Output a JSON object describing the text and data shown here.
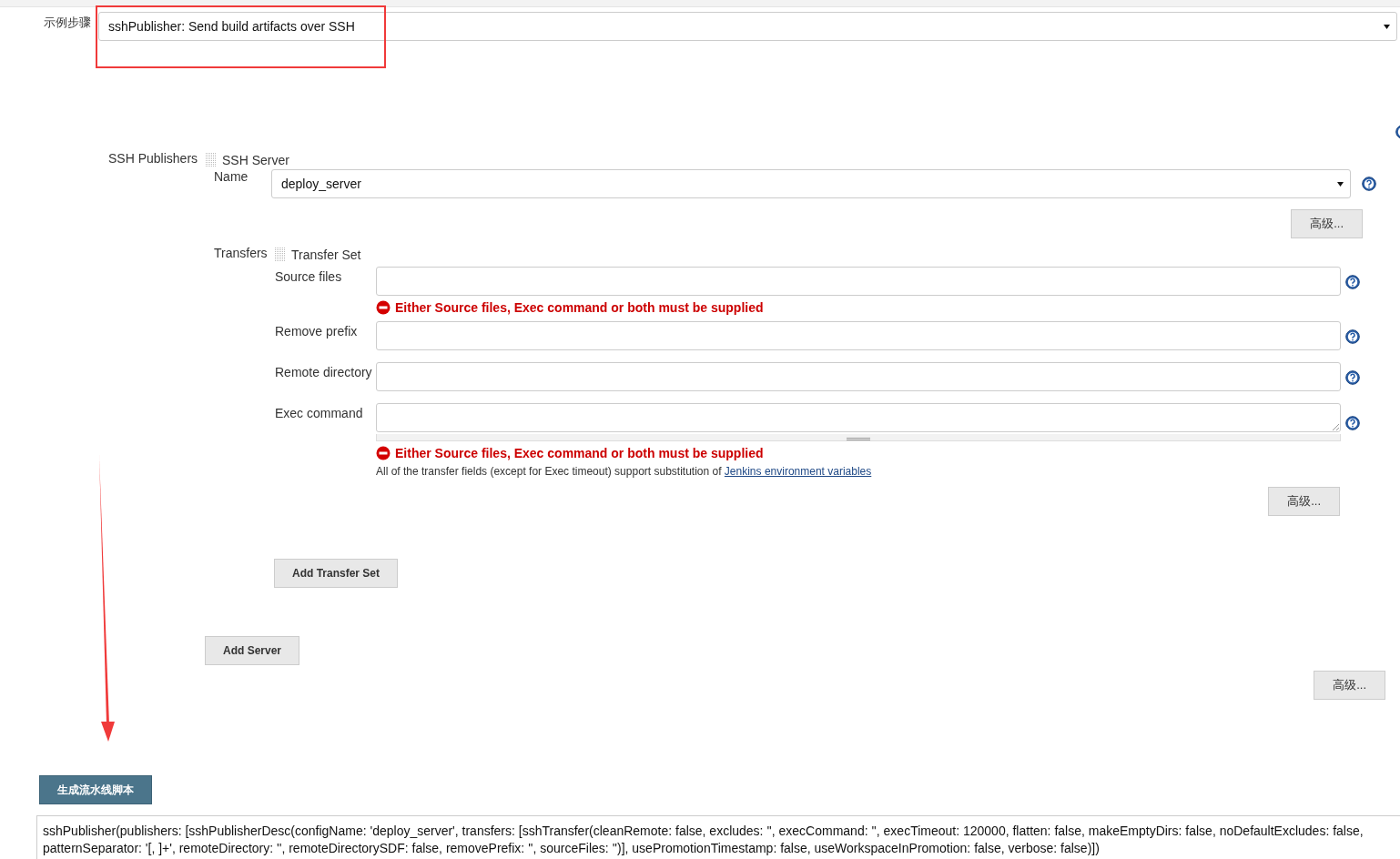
{
  "step": {
    "label": "示例步骤",
    "value": "sshPublisher: Send build artifacts over SSH"
  },
  "ssh_publishers": {
    "label": "SSH Publishers",
    "server_heading": "SSH Server",
    "name_label": "Name",
    "name_value": "deploy_server",
    "advanced_button": "高级...",
    "transfers_label": "Transfers",
    "transfer_heading": "Transfer Set",
    "fields": [
      {
        "label": "Source files",
        "kind": "text",
        "error": "Either Source files, Exec command or both must be supplied"
      },
      {
        "label": "Remove prefix",
        "kind": "text"
      },
      {
        "label": "Remote directory",
        "kind": "text"
      },
      {
        "label": "Exec command",
        "kind": "textarea",
        "error": "Either Source files, Exec command or both must be supplied"
      }
    ],
    "note": "All of the transfer fields (except for Exec timeout) support substitution of ",
    "note_link": "Jenkins environment variables",
    "transfer_advanced_button": "高级...",
    "add_transfer_button": "Add Transfer Set",
    "add_server_button": "Add Server",
    "publisher_advanced_button": "高级..."
  },
  "generate_button": "生成流水线脚本",
  "script_output": "sshPublisher(publishers: [sshPublisherDesc(configName: 'deploy_server', transfers: [sshTransfer(cleanRemote: false, excludes: '', execCommand: '', execTimeout: 120000, flatten: false, makeEmptyDirs: false, noDefaultExcludes: false, patternSeparator: '[, ]+', remoteDirectory: '', remoteDirectorySDF: false, removePrefix: '', sourceFiles: '')], usePromotionTimestamp: false, useWorkspaceInPromotion: false, verbose: false)])"
}
